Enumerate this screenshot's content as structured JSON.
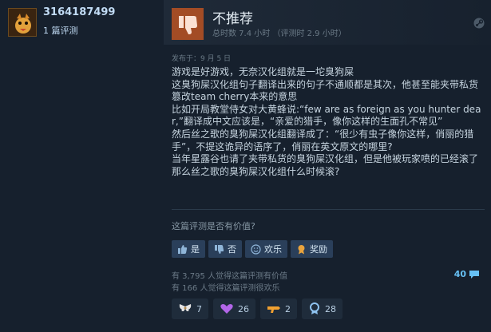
{
  "author": {
    "username": "3164187499",
    "review_count": "1 篇评测"
  },
  "review": {
    "recommendation": "不推荐",
    "hours": "总时数 7.4 小时 （评测时 2.9 小时）",
    "posted": "发布于：9 月 5 日",
    "body_lines": [
      "游戏是好游戏，无奈汉化组就是一坨臭狗屎",
      "这臭狗屎汉化组句子翻译出来的句子不通顺都是其次，他甚至能夹带私货篡改team cherry本来的意思",
      "比如开局教堂侍女对大黄蜂说:“few are as foreign as you hunter dear,”翻译成中文应该是，“亲爱的猎手，像你这样的生面孔不常见”",
      "然后丝之歌的臭狗屎汉化组翻译成了：“很少有虫子像你这样，俏丽的猎手”，不提这诡异的语序了，俏丽在英文原文的哪里?",
      "当年星露谷也请了夹带私货的臭狗屎汉化组，但是他被玩家喷的已经滚了",
      "那么丝之歌的臭狗屎汉化组什么时候滚?"
    ]
  },
  "feedback": {
    "question": "这篇评测是否有价值?",
    "buttons": [
      "是",
      "否",
      "欢乐",
      "奖励"
    ],
    "helpful_stat": "有 3,795 人觉得这篇评测有价值",
    "funny_stat": "有 166 人觉得这篇评测很欢乐",
    "comment_count": "40"
  },
  "awards": [
    {
      "icon": "wings-award-icon",
      "count": "7"
    },
    {
      "icon": "heart-award-icon",
      "count": "26"
    },
    {
      "icon": "gun-award-icon",
      "count": "2"
    },
    {
      "icon": "medal-award-icon",
      "count": "28"
    }
  ],
  "colors": {
    "background": "#1b2838",
    "not_recommended": "#a34c25",
    "link": "#66c0f4",
    "button": "#2a3f5a"
  }
}
